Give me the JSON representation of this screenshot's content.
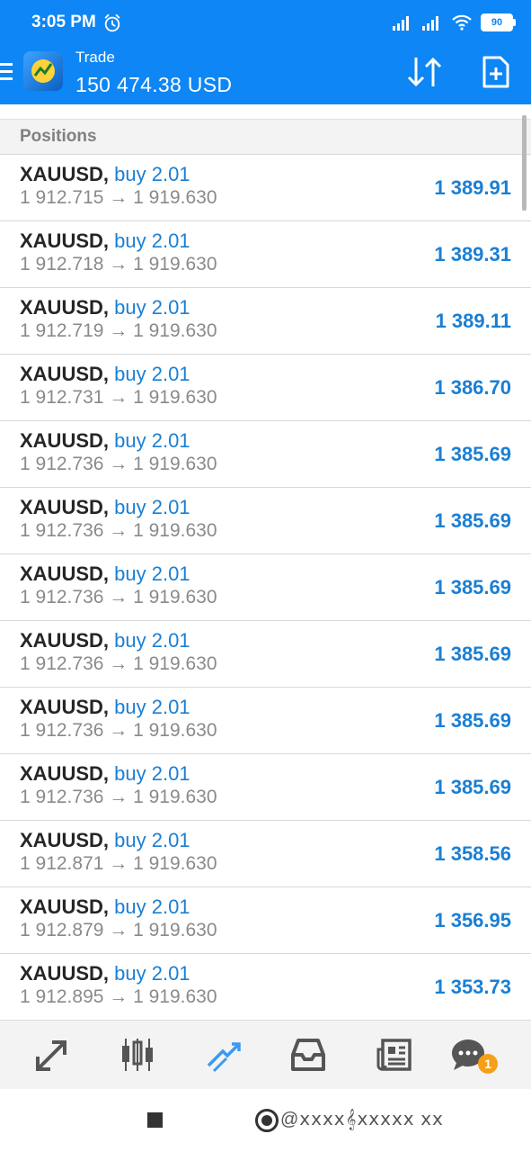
{
  "status_bar": {
    "time": "3:05 PM",
    "battery": "90"
  },
  "header": {
    "title": "Trade",
    "balance": "150 474.38 USD"
  },
  "section": {
    "title": "Positions"
  },
  "positions": [
    {
      "symbol": "XAUUSD",
      "side": "buy 2.01",
      "price_line": "1 912.715 → 1 919.630",
      "profit": "1 389.91"
    },
    {
      "symbol": "XAUUSD",
      "side": "buy 2.01",
      "price_line": "1 912.718 → 1 919.630",
      "profit": "1 389.31"
    },
    {
      "symbol": "XAUUSD",
      "side": "buy 2.01",
      "price_line": "1 912.719 → 1 919.630",
      "profit": "1 389.11"
    },
    {
      "symbol": "XAUUSD",
      "side": "buy 2.01",
      "price_line": "1 912.731 → 1 919.630",
      "profit": "1 386.70"
    },
    {
      "symbol": "XAUUSD",
      "side": "buy 2.01",
      "price_line": "1 912.736 → 1 919.630",
      "profit": "1 385.69"
    },
    {
      "symbol": "XAUUSD",
      "side": "buy 2.01",
      "price_line": "1 912.736 → 1 919.630",
      "profit": "1 385.69"
    },
    {
      "symbol": "XAUUSD",
      "side": "buy 2.01",
      "price_line": "1 912.736 → 1 919.630",
      "profit": "1 385.69"
    },
    {
      "symbol": "XAUUSD",
      "side": "buy 2.01",
      "price_line": "1 912.736 → 1 919.630",
      "profit": "1 385.69"
    },
    {
      "symbol": "XAUUSD",
      "side": "buy 2.01",
      "price_line": "1 912.736 → 1 919.630",
      "profit": "1 385.69"
    },
    {
      "symbol": "XAUUSD",
      "side": "buy 2.01",
      "price_line": "1 912.736 → 1 919.630",
      "profit": "1 385.69"
    },
    {
      "symbol": "XAUUSD",
      "side": "buy 2.01",
      "price_line": "1 912.871 → 1 919.630",
      "profit": "1 358.56"
    },
    {
      "symbol": "XAUUSD",
      "side": "buy 2.01",
      "price_line": "1 912.879 → 1 919.630",
      "profit": "1 356.95"
    },
    {
      "symbol": "XAUUSD",
      "side": "buy 2.01",
      "price_line": "1 912.895 → 1 919.630",
      "profit": "1 353.73"
    }
  ],
  "bottom_nav": {
    "items": [
      {
        "icon": "quotes-icon"
      },
      {
        "icon": "chart-icon"
      },
      {
        "icon": "trade-icon",
        "active": true
      },
      {
        "icon": "history-icon"
      },
      {
        "icon": "news-icon"
      },
      {
        "icon": "chat-icon"
      }
    ],
    "chat_badge": "1"
  },
  "watermark": "@ⅹⅹⅹⅹ𝄞ⅹⅹⅹⅹⅹ ⅹⅹ",
  "colors": {
    "header_bg": "#0e86f5",
    "accent_blue": "#1a7fd4",
    "nav_active": "#3a9af0",
    "badge": "#f5a01a"
  }
}
